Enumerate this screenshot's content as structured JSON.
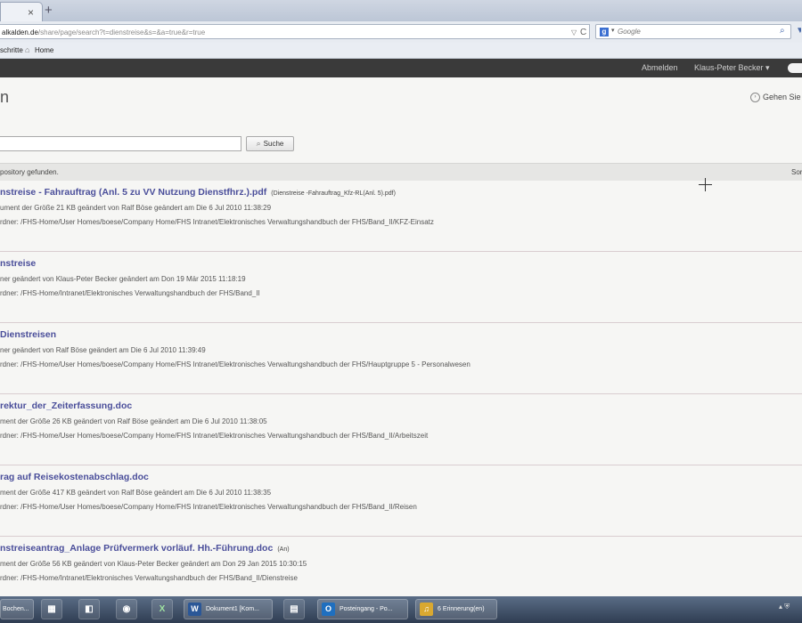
{
  "browser": {
    "tab_close_glyph": "×",
    "new_tab_glyph": "+",
    "url_host": "alkalden.de",
    "url_path": "/share/page/search?t=dienstreise&s=&a=true&r=true",
    "url_dropdown_glyph": "▽",
    "reload_glyph": "C",
    "search_engine_letter": "g",
    "search_engine_dropdown": "▾",
    "search_placeholder": "Google",
    "search_icon_glyph": "⌕",
    "bookmarks": [
      {
        "label": "schritte"
      },
      {
        "label": "Home"
      }
    ]
  },
  "app": {
    "topnav": {
      "logout": "Abmelden",
      "user": "Klaus-Peter Becker ▾"
    },
    "page_title": "n",
    "goto_label": "Gehen Sie z",
    "search_button": "Suche",
    "result_count": "pository gefunden.",
    "sort_label": "Sor",
    "results": [
      {
        "title": "nstreise - Fahrauftrag (Anl. 5 zu VV Nutzung Dienstfhrz.).pdf",
        "extra": "(Dienstreise -Fahrauftrag_Kfz-RL(Anl. 5).pdf)",
        "meta": "ument der Größe 21 KB geändert von Ralf Böse geändert am Die 6 Jul 2010 11:38:29",
        "path": "rdner: /FHS-Home/User Homes/boese/Company Home/FHS Intranet/Elektronisches Verwaltungshandbuch der FHS/Band_II/KFZ-Einsatz"
      },
      {
        "title": "nstreise",
        "extra": "",
        "meta": "ner geändert von Klaus-Peter Becker geändert am Don 19 Mär 2015 11:18:19",
        "path": "rdner: /FHS-Home/Intranet/Elektronisches Verwaltungshandbuch der FHS/Band_II"
      },
      {
        "title": "Dienstreisen",
        "extra": "",
        "meta": "ner geändert von Ralf Böse geändert am Die 6 Jul 2010 11:39:49",
        "path": "rdner: /FHS-Home/User Homes/boese/Company Home/FHS Intranet/Elektronisches Verwaltungshandbuch der FHS/Hauptgruppe 5 - Personalwesen"
      },
      {
        "title": "rektur_der_Zeiterfassung.doc",
        "extra": "",
        "meta": "ment der Größe 26 KB geändert von Ralf Böse geändert am Die 6 Jul 2010 11:38:05",
        "path": "rdner: /FHS-Home/User Homes/boese/Company Home/FHS Intranet/Elektronisches Verwaltungshandbuch der FHS/Band_II/Arbeitszeit"
      },
      {
        "title": "rag auf Reisekostenabschlag.doc",
        "extra": "",
        "meta": "ment der Größe 417 KB geändert von Ralf Böse geändert am Die 6 Jul 2010 11:38:35",
        "path": "rdner: /FHS-Home/User Homes/boese/Company Home/FHS Intranet/Elektronisches Verwaltungshandbuch der FHS/Band_II/Reisen"
      },
      {
        "title": "nstreiseantrag_Anlage Prüfvermerk vorläuf. Hh.-Führung.doc",
        "extra": "(An)",
        "meta": "ment der Größe 56 KB geändert von Klaus-Peter Becker geändert am Don 29 Jan 2015 10:30:15",
        "path": "rdner: /FHS-Home/Intranet/Elektronisches Verwaltungshandbuch der FHS/Band_II/Dienstreise"
      }
    ]
  },
  "taskbar": {
    "items": [
      {
        "label": "Bochen...",
        "name": "taskbar-search-partial"
      },
      {
        "label": "",
        "name": "taskbar-app-calculator",
        "glyph": "▦"
      },
      {
        "label": "",
        "name": "taskbar-app-outlook-classic",
        "glyph": "◧"
      },
      {
        "label": "",
        "name": "taskbar-app-firefox",
        "glyph": "◉"
      },
      {
        "label": "",
        "name": "taskbar-app-excel",
        "glyph": "X"
      },
      {
        "label": "Dokument1 [Kom...",
        "name": "taskbar-word-document",
        "glyph": "W"
      },
      {
        "label": "",
        "name": "taskbar-app-explorer",
        "glyph": "▤"
      },
      {
        "label": "Posteingang - Po...",
        "name": "taskbar-outlook-inbox",
        "glyph": "O"
      },
      {
        "label": "6 Erinnerung(en)",
        "name": "taskbar-reminders",
        "glyph": "♫"
      }
    ],
    "tray_glyph": "▴ ⛨"
  },
  "colors": {
    "app_header": "#3a3a3a",
    "link": "#4a4e9a",
    "taskbar": "#3c4a60"
  }
}
